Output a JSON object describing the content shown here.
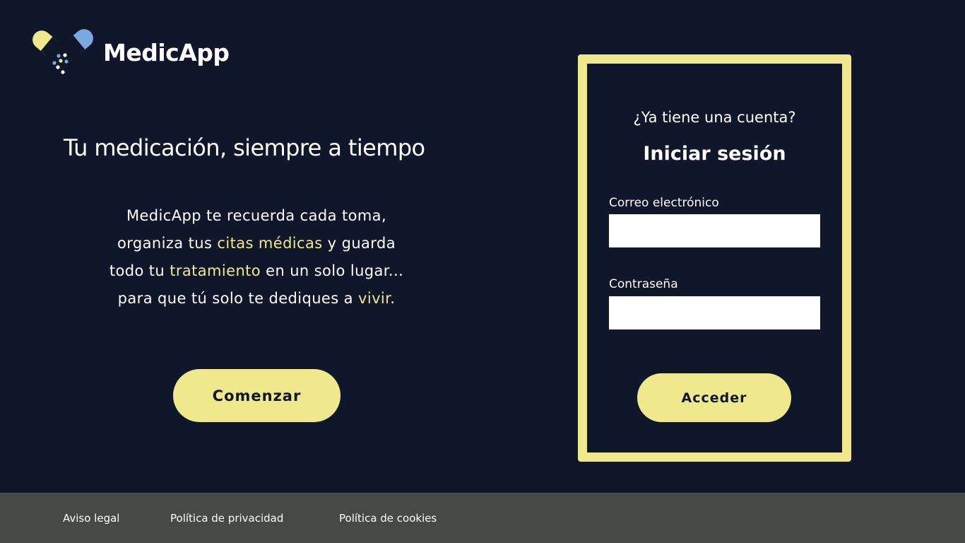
{
  "brand": {
    "name": "MedicApp",
    "colors": {
      "background": "#10172a",
      "accent": "#efe88d",
      "pill_blue": "#7aa9e0",
      "footer": "#474a44"
    }
  },
  "hero": {
    "title": "Tu medicación, siempre a tiempo",
    "lines": [
      {
        "before": "MedicApp te recuerda cada toma,",
        "highlight": "",
        "after": ""
      },
      {
        "before": "organiza tus ",
        "highlight": "citas médicas",
        "after": " y guarda"
      },
      {
        "before": "todo tu ",
        "highlight": "tratamiento",
        "after": " en un solo lugar..."
      },
      {
        "before": "para que tú solo te dediques a ",
        "highlight": "vivir",
        "after": "."
      }
    ],
    "cta_label": "Comenzar"
  },
  "login": {
    "question": "¿Ya tiene una cuenta?",
    "title": "Iniciar sesión",
    "email_label": "Correo electrónico",
    "email_value": "",
    "password_label": "Contraseña",
    "password_value": "",
    "submit_label": "Acceder"
  },
  "footer": {
    "links": [
      "Aviso legal",
      "Política de privacidad",
      "Política de cookies"
    ]
  }
}
